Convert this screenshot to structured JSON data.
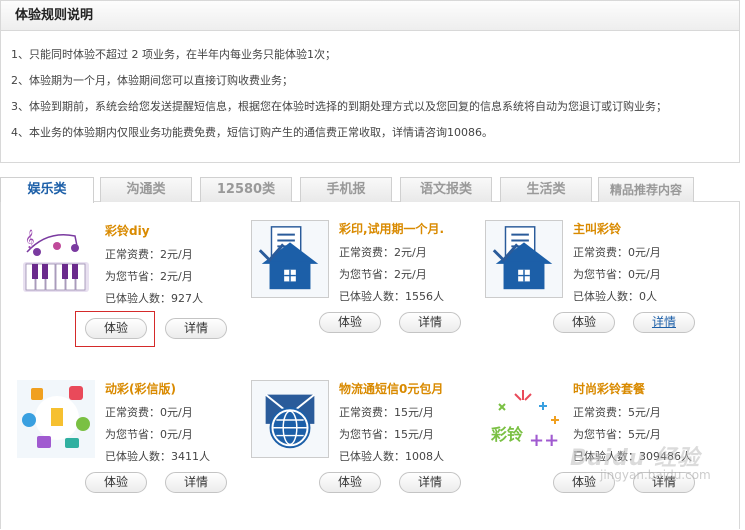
{
  "rules": {
    "title": "体验规则说明",
    "items": [
      "1、只能同时体验不超过 2 项业务，在半年内每业务只能体验1次；",
      "2、体验期为一个月，体验期间您可以直接订购收费业务；",
      "3、体验到期前，系统会给您发送提醒短信息，根据您在体验时选择的到期处理方式以及您回复的信息系统将自动为您退订或订购业务；",
      "4、本业务的体验期内仅限业务功能费免费，短信订购产生的通信费正常收取，详情请咨询10086。"
    ]
  },
  "tabs": [
    "娱乐类",
    "沟通类",
    "12580类",
    "手机报",
    "语文报类",
    "生活类",
    "精品推荐内容"
  ],
  "active_tab": "娱乐类",
  "labels": {
    "normal_fee": "正常资费：",
    "savings": "为您节省：",
    "experienced": "已体验人数：",
    "try_button": "体验",
    "details_button": "详情"
  },
  "cards": [
    {
      "title": "彩铃diy",
      "fee": "2元/月",
      "save": "2元/月",
      "count": "927人",
      "thumb": "music-notes-piano-icon"
    },
    {
      "title": "彩印,试用期一个月.",
      "fee": "2元/月",
      "save": "2元/月",
      "count": "1556人",
      "thumb": "house-document-icon"
    },
    {
      "title": "主叫彩铃",
      "fee": "0元/月",
      "save": "0元/月",
      "count": "0人",
      "thumb": "house-document-icon"
    },
    {
      "title": "动彩(彩信版)",
      "fee": "0元/月",
      "save": "0元/月",
      "count": "3411人",
      "thumb": "colorful-apps-icon"
    },
    {
      "title": "物流通短信0元包月",
      "fee": "15元/月",
      "save": "15元/月",
      "count": "1008人",
      "thumb": "envelope-globe-icon"
    },
    {
      "title": "时尚彩铃套餐",
      "fee": "5元/月",
      "save": "5元/月",
      "count": "309486人",
      "thumb": "fireworks-text-icon"
    }
  ],
  "watermark": {
    "brand": "Baidu 经验",
    "url": "jingyan.baidu.com"
  },
  "colors": {
    "accent": "#1c5fa8",
    "title_orange": "#d98a00",
    "highlight": "#d42a2a"
  }
}
